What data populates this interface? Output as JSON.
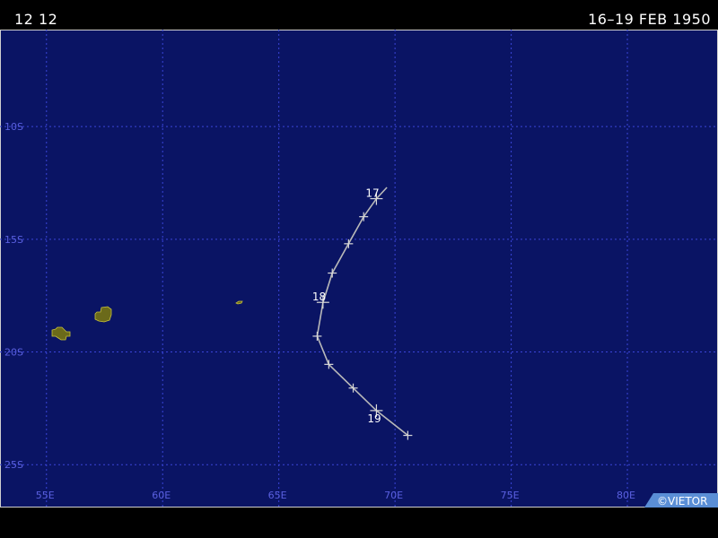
{
  "header": {
    "left_title": "12 12",
    "right_title": "16–19 FEB 1950"
  },
  "map": {
    "ocean_color": "#0a1464",
    "grid_color": "#3a45d8",
    "land_color": "#6b6a1a",
    "track_color": "#b9b9b9",
    "lon_range": [
      53,
      83.9
    ],
    "lat_range": [
      -5.7,
      -26.9
    ],
    "lon_ticks": [
      {
        "value": 55,
        "label": "55E"
      },
      {
        "value": 60,
        "label": "60E"
      },
      {
        "value": 65,
        "label": "65E"
      },
      {
        "value": 70,
        "label": "70E"
      },
      {
        "value": 75,
        "label": "75E"
      },
      {
        "value": 80,
        "label": "80E"
      }
    ],
    "lat_ticks": [
      {
        "value": -10,
        "label": "10S"
      },
      {
        "value": -15,
        "label": "15S"
      },
      {
        "value": -20,
        "label": "20S"
      },
      {
        "value": -25,
        "label": "25S"
      }
    ],
    "credit": "©VIETOR"
  },
  "track": {
    "points": [
      {
        "lon": 69.65,
        "lat": -12.7
      },
      {
        "lon": 69.2,
        "lat": -13.2,
        "label": "17",
        "major": true
      },
      {
        "lon": 68.65,
        "lat": -14.0
      },
      {
        "lon": 68.0,
        "lat": -15.2
      },
      {
        "lon": 67.3,
        "lat": -16.5
      },
      {
        "lon": 66.9,
        "lat": -17.8,
        "label": "18",
        "major": true
      },
      {
        "lon": 66.65,
        "lat": -19.3
      },
      {
        "lon": 67.15,
        "lat": -20.55
      },
      {
        "lon": 68.2,
        "lat": -21.6
      },
      {
        "lon": 69.2,
        "lat": -22.6,
        "label": "19",
        "major": true
      },
      {
        "lon": 70.55,
        "lat": -23.7
      }
    ]
  },
  "chart_data": {
    "type": "scatter",
    "x": [
      69.65,
      69.2,
      68.65,
      68.0,
      67.3,
      66.9,
      66.65,
      67.15,
      68.2,
      69.2,
      70.55
    ],
    "y": [
      -12.7,
      -13.2,
      -14.0,
      -15.2,
      -16.5,
      -17.8,
      -19.3,
      -20.55,
      -21.6,
      -22.6,
      -23.7
    ],
    "annotations": [
      "17",
      "18",
      "19"
    ],
    "title": "16–19 FEB 1950"
  }
}
